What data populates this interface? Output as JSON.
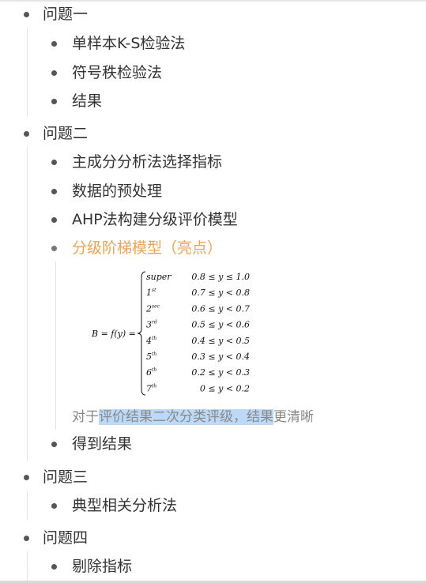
{
  "outline": {
    "q1": {
      "title": "问题一",
      "items": [
        "单样本K-S检验法",
        "符号秩检验法",
        "结果"
      ]
    },
    "q2": {
      "title": "问题二",
      "items": [
        "主成分分析法选择指标",
        "数据的预处理",
        "AHP法构建分级评价模型"
      ],
      "highlight_item": "分级阶梯模型（亮点）",
      "formula": {
        "lhs": "B = f(y) =",
        "rows": [
          {
            "grade": "super",
            "sup": "",
            "range": "0.8 ≤ y ≤ 1.0"
          },
          {
            "grade": "1",
            "sup": "st",
            "range": "0.7 ≤ y < 0.8"
          },
          {
            "grade": "2",
            "sup": "sec",
            "range": "0.6 ≤ y < 0.7"
          },
          {
            "grade": "3",
            "sup": "rd",
            "range": "0.5 ≤ y < 0.6"
          },
          {
            "grade": "4",
            "sup": "th",
            "range": "0.4 ≤ y < 0.5"
          },
          {
            "grade": "5",
            "sup": "th",
            "range": "0.3 ≤ y < 0.4"
          },
          {
            "grade": "6",
            "sup": "th",
            "range": "0.2 ≤ y < 0.3"
          },
          {
            "grade": "7",
            "sup": "th",
            "range": "0 ≤ y < 0.2"
          }
        ]
      },
      "note_prefix": "对于",
      "note_selected": "评价结果二次分类评级，结果",
      "note_suffix": "更清晰",
      "last_item": "得到结果"
    },
    "q3": {
      "title": "问题三",
      "items": [
        "典型相关分析法"
      ]
    },
    "q4": {
      "title": "问题四",
      "items": [
        "剔除指标"
      ]
    }
  },
  "colors": {
    "highlight": "#f0a44f",
    "selection": "#bcd9f7",
    "text": "#333333",
    "note": "#888888"
  }
}
